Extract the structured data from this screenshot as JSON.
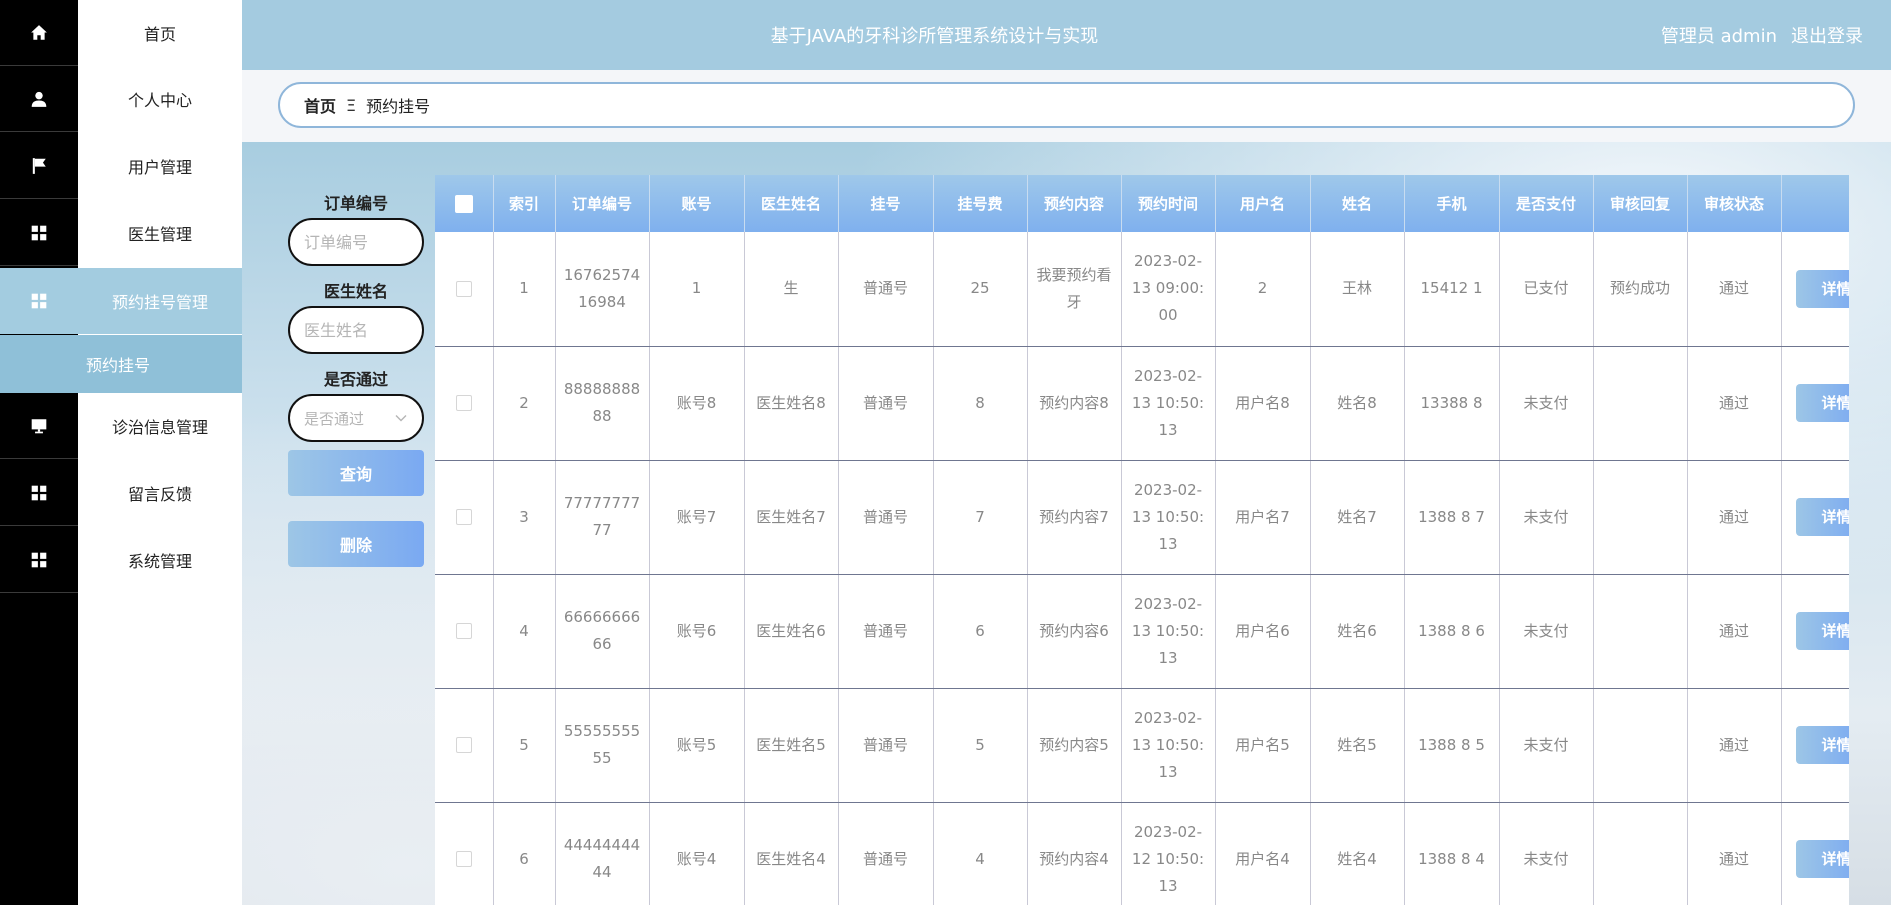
{
  "header": {
    "title": "基于JAVA的牙科诊所管理系统设计与实现",
    "admin_label": "管理员 admin",
    "logout_label": "退出登录"
  },
  "sidebar": {
    "items": [
      {
        "label": "首页",
        "icon": "home-icon"
      },
      {
        "label": "个人中心",
        "icon": "person-icon"
      },
      {
        "label": "用户管理",
        "icon": "flag-icon"
      },
      {
        "label": "医生管理",
        "icon": "grid-icon"
      },
      {
        "label": "预约挂号管理",
        "icon": "grid-icon"
      },
      {
        "label": "诊治信息管理",
        "icon": "monitor-icon"
      },
      {
        "label": "留言反馈",
        "icon": "grid-icon"
      },
      {
        "label": "系统管理",
        "icon": "grid-icon"
      }
    ],
    "sub_item": "预约挂号"
  },
  "breadcrumb": {
    "home": "首页",
    "separator": "Ξ",
    "current": "预约挂号"
  },
  "search": {
    "order_label": "订单编号",
    "order_placeholder": "订单编号",
    "doctor_label": "医生姓名",
    "doctor_placeholder": "医生姓名",
    "pass_label": "是否通过",
    "pass_placeholder": "是否通过",
    "query_button": "查询",
    "delete_button": "删除"
  },
  "table": {
    "headers": [
      "索引",
      "订单编号",
      "账号",
      "医生姓名",
      "挂号",
      "挂号费",
      "预约内容",
      "预约时间",
      "用户名",
      "姓名",
      "手机",
      "是否支付",
      "审核回复",
      "审核状态"
    ],
    "detail_label": "详情",
    "rows": [
      {
        "index": "1",
        "order": "1676257416984",
        "account": "1",
        "doctor": "生",
        "type": "普通号",
        "fee": "25",
        "content": "我要预约看牙",
        "time": "2023-02-13 09:00:00",
        "username": "2",
        "name": "王林",
        "phone": "15412 1",
        "paid": "已支付",
        "reply": "预约成功",
        "status": "通过"
      },
      {
        "index": "2",
        "order": "8888888888",
        "account": "账号8",
        "doctor": "医生姓名8",
        "type": "普通号",
        "fee": "8",
        "content": "预约内容8",
        "time": "2023-02-13 10:50:13",
        "username": "用户名8",
        "name": "姓名8",
        "phone": "13388 8",
        "paid": "未支付",
        "reply": "",
        "status": "通过"
      },
      {
        "index": "3",
        "order": "7777777777",
        "account": "账号7",
        "doctor": "医生姓名7",
        "type": "普通号",
        "fee": "7",
        "content": "预约内容7",
        "time": "2023-02-13 10:50:13",
        "username": "用户名7",
        "name": "姓名7",
        "phone": "1388 8 7",
        "paid": "未支付",
        "reply": "",
        "status": "通过"
      },
      {
        "index": "4",
        "order": "6666666666",
        "account": "账号6",
        "doctor": "医生姓名6",
        "type": "普通号",
        "fee": "6",
        "content": "预约内容6",
        "time": "2023-02-13 10:50:13",
        "username": "用户名6",
        "name": "姓名6",
        "phone": "1388 8 6",
        "paid": "未支付",
        "reply": "",
        "status": "通过"
      },
      {
        "index": "5",
        "order": "5555555555",
        "account": "账号5",
        "doctor": "医生姓名5",
        "type": "普通号",
        "fee": "5",
        "content": "预约内容5",
        "time": "2023-02-13 10:50:13",
        "username": "用户名5",
        "name": "姓名5",
        "phone": "1388 8 5",
        "paid": "未支付",
        "reply": "",
        "status": "通过"
      },
      {
        "index": "6",
        "order": "4444444444",
        "account": "账号4",
        "doctor": "医生姓名4",
        "type": "普通号",
        "fee": "4",
        "content": "预约内容4",
        "time": "2023-02-12 10:50:13",
        "username": "用户名4",
        "name": "姓名4",
        "phone": "1388 8 4",
        "paid": "未支付",
        "reply": "",
        "status": "通过"
      }
    ]
  }
}
